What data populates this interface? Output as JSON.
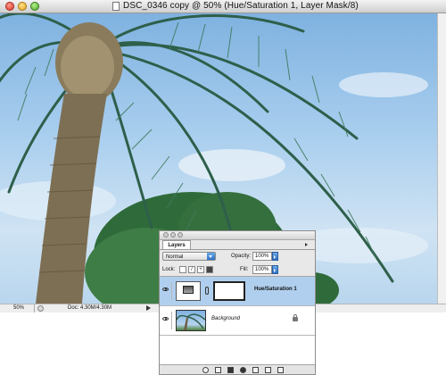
{
  "window": {
    "title": "DSC_0346 copy @ 50% (Hue/Saturation 1, Layer Mask/8)"
  },
  "status": {
    "zoom": "50%",
    "doc_size": "Doc: 4.30M/4.30M"
  },
  "layers_panel": {
    "tab_label": "Layers",
    "blend_mode": "Normal",
    "opacity_label": "Opacity:",
    "opacity_value": "100%",
    "lock_label": "Lock:",
    "fill_label": "Fill:",
    "fill_value": "100%",
    "layers": [
      {
        "name": "Hue/Saturation 1",
        "selected": true
      },
      {
        "name": "Background",
        "selected": false
      }
    ]
  },
  "colors": {
    "selection": "#b0cfee",
    "sky": "#a7cdee",
    "palm_trunk": "#8a7b5c",
    "foliage": "#2f6b3a"
  }
}
